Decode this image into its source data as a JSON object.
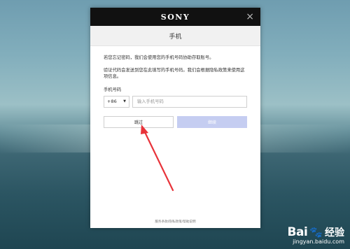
{
  "brand": "SONY",
  "dialog": {
    "title": "手机",
    "close_glyph": "×",
    "paragraph1": "若您忘记密码，我们会使用您的手机号码协助存取账号。",
    "paragraph2": "验证代码会发送到您在此填写的手机号码。我们会根据隐私政策来使用这项信息。",
    "phone_label": "手机号码",
    "country_code": "+86",
    "country_caret": "▼",
    "phone_placeholder": "输入手机号码",
    "phone_value": "",
    "skip_label": "跳过",
    "next_label": "继续",
    "footer_links": "服务条款/隐私政策/帮助说明"
  },
  "annotation": {
    "arrow_color": "#e8333a"
  },
  "watermark": {
    "brand": "Bai",
    "paw": "🐾",
    "suffix": "经验",
    "url": "jingyan.baidu.com"
  },
  "colors": {
    "topbar": "#111111",
    "next_button": "#c5cdf1"
  }
}
